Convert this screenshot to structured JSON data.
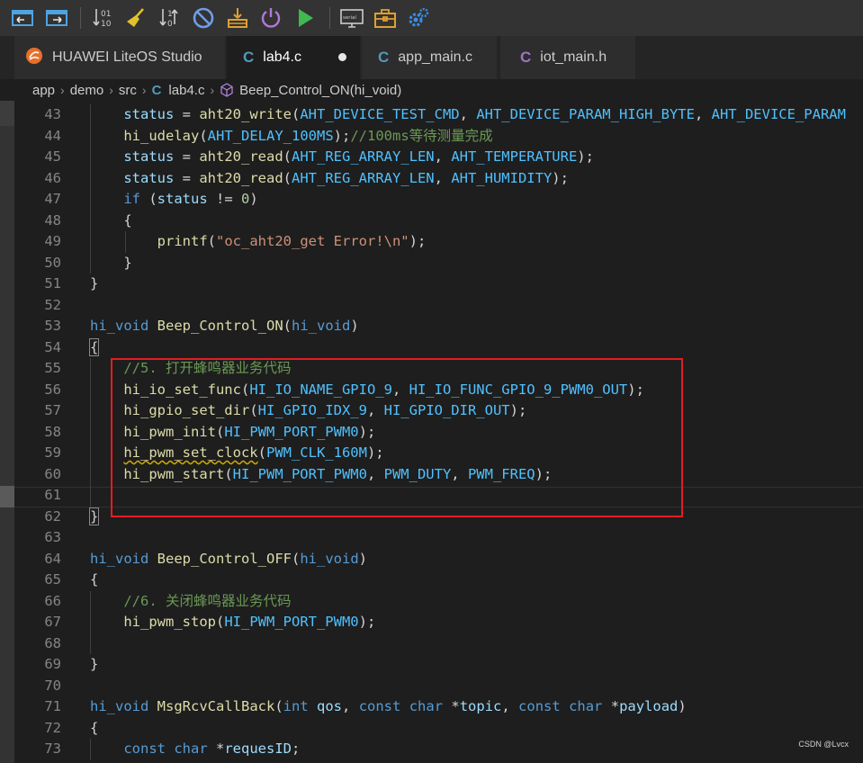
{
  "toolbar": {
    "buttons": [
      {
        "name": "window-restore-icon",
        "color": "#4fa3e0"
      },
      {
        "name": "window-export-icon",
        "color": "#4fa3e0"
      },
      {
        "name": "sort-01-10-icon",
        "color": "#cccccc"
      },
      {
        "name": "clean-broom-icon",
        "color": "#e2c12a"
      },
      {
        "name": "sort-swap-icon",
        "color": "#cccccc"
      },
      {
        "name": "stop-ban-icon",
        "color": "#6f9de8"
      },
      {
        "name": "download-tray-icon",
        "color": "#e0a030"
      },
      {
        "name": "power-icon",
        "color": "#b07ad6"
      },
      {
        "name": "run-play-icon",
        "color": "#3fb950"
      },
      {
        "name": "serial-monitor-icon",
        "color": "#cccccc"
      },
      {
        "name": "toolbox-icon",
        "color": "#e0a030"
      },
      {
        "name": "settings-gears-icon",
        "color": "#3a8ee6"
      }
    ],
    "sort_label_top": "01",
    "sort_label_bottom": "10",
    "serial_label": "serial"
  },
  "tabs": [
    {
      "label": "HUAWEI LiteOS Studio",
      "icon": "liteos-logo-icon",
      "icon_color": "#e8702a"
    },
    {
      "label": "lab4.c",
      "icon_text": "C",
      "icon_color": "#519aba",
      "modified": true
    },
    {
      "label": "app_main.c",
      "icon_text": "C",
      "icon_color": "#519aba"
    },
    {
      "label": "iot_main.h",
      "icon_text": "C",
      "icon_color": "#a074c4"
    }
  ],
  "breadcrumb": {
    "items": [
      "app",
      "demo",
      "src",
      "lab4.c",
      "Beep_Control_ON(hi_void)"
    ],
    "file_icon_text": "C",
    "symbol_icon": "method-cube-icon"
  },
  "code": {
    "line_numbers": [
      "43",
      "44",
      "45",
      "46",
      "47",
      "48",
      "49",
      "50",
      "51",
      "52",
      "53",
      "54",
      "55",
      "56",
      "57",
      "58",
      "59",
      "60",
      "61",
      "62",
      "63",
      "64",
      "65",
      "66",
      "67",
      "68",
      "69",
      "70",
      "71",
      "72",
      "73"
    ]
  },
  "watermark": "CSDN @Lvcx"
}
